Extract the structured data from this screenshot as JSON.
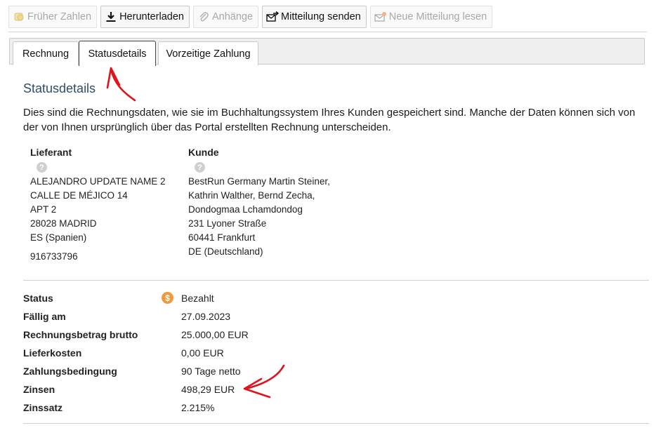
{
  "toolbar": {
    "pay_early": "Früher Zahlen",
    "download": "Herunterladen",
    "attachments": "Anhänge",
    "send_message": "Mitteilung senden",
    "read_message": "Neue Mitteilung lesen"
  },
  "tabs": [
    "Rechnung",
    "Statusdetails",
    "Vorzeitige Zahlung"
  ],
  "section": {
    "title": "Statusdetails",
    "intro": "Dies sind die Rechnungsdaten, wie sie im Buchhaltungssystem Ihres Kunden gespeichert sind. Manche der Daten können sich von der von Ihnen ursprünglich über das Portal erstellten Rechnung unterscheiden."
  },
  "supplier": {
    "heading": "Lieferant",
    "lines": [
      "ALEJANDRO UPDATE NAME 2",
      "CALLE DE MÉJICO 14",
      "APT 2",
      "28028 MADRID",
      "ES (Spanien)"
    ],
    "phone": "916733796"
  },
  "customer": {
    "heading": "Kunde",
    "lines": [
      "BestRun Germany Martin Steiner,",
      "Kathrin Walther, Bernd Zecha,",
      "Dondogmaa Lchamdondog",
      "231 Lyoner Straße",
      "60441 Frankfurt",
      "DE (Deutschland)"
    ]
  },
  "details": {
    "status_label": "Status",
    "status_value": "Bezahlt",
    "status_icon": "$",
    "due_label": "Fällig am",
    "due_value": "27.09.2023",
    "gross_label": "Rechnungsbetrag brutto",
    "gross_value": "25.000,00 EUR",
    "shipping_label": "Lieferkosten",
    "shipping_value": "0,00 EUR",
    "terms_label": "Zahlungsbedingung",
    "terms_value": "90 Tage netto",
    "interest_label": "Zinsen",
    "interest_value": "498,29 EUR",
    "rate_label": "Zinssatz",
    "rate_value": "2.215%"
  },
  "help_icon": "?",
  "colors": {
    "accent_title": "#2d4d68",
    "status_icon": "#f09a3e",
    "annotation": "#e0121c"
  }
}
